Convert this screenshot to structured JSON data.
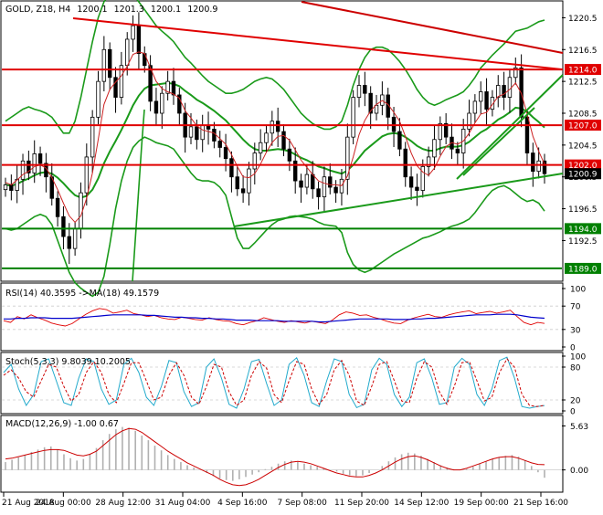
{
  "chart_data": [
    {
      "type": "candlestick",
      "title": "GOLD, Z18, H4",
      "ohlc": [
        "1200.1",
        "1201.3",
        "1200.1",
        "1200.9"
      ],
      "ylim": [
        1187.5,
        1222.5
      ],
      "yticks": [
        1192.5,
        1196.5,
        1200.5,
        1204.5,
        1208.5,
        1212.5,
        1216.5,
        1220.5
      ],
      "ytick_labels": [
        "1192.5",
        "1196.5",
        "1200.5",
        "1204.5",
        "1208.5",
        "1212.5",
        "1216.5",
        "1220.5"
      ],
      "xtick_labels": [
        "21 Aug 2018",
        "24 Aug 00:00",
        "28 Aug 12:00",
        "31 Aug 04:00",
        "4 Sep 16:00",
        "7 Sep 08:00",
        "11 Sep 20:00",
        "14 Sep 12:00",
        "19 Sep 00:00",
        "21 Sep 16:00"
      ],
      "horizontal_levels": [
        {
          "value": 1214.0,
          "label": "1214.0",
          "color": "#e00000"
        },
        {
          "value": 1207.0,
          "label": "1207.0",
          "color": "#e00000"
        },
        {
          "value": 1202.0,
          "label": "1202.0",
          "color": "#e00000"
        },
        {
          "value": 1194.0,
          "label": "1194.0",
          "color": "#008000"
        },
        {
          "value": 1189.0,
          "label": "1189.0",
          "color": "#008000"
        }
      ],
      "current_price": {
        "value": 1200.9,
        "label": "1200.9"
      },
      "closes": [
        1199.5,
        1198.8,
        1200.2,
        1202.5,
        1201.0,
        1203.4,
        1202.2,
        1200.5,
        1197.8,
        1195.5,
        1193.0,
        1191.5,
        1194.0,
        1198.5,
        1203.0,
        1208.0,
        1212.5,
        1216.5,
        1213.0,
        1210.5,
        1214.5,
        1217.8,
        1219.5,
        1216.0,
        1214.5,
        1210.0,
        1208.5,
        1211.0,
        1212.5,
        1210.8,
        1208.5,
        1205.5,
        1206.8,
        1205.2,
        1207.0,
        1206.5,
        1205.0,
        1204.2,
        1202.8,
        1200.5,
        1199.0,
        1198.5,
        1201.5,
        1203.5,
        1204.8,
        1206.0,
        1207.5,
        1206.2,
        1204.0,
        1202.5,
        1200.0,
        1199.2,
        1200.8,
        1199.0,
        1198.0,
        1200.5,
        1199.2,
        1198.5,
        1200.2,
        1205.5,
        1210.5,
        1212.0,
        1211.0,
        1208.5,
        1209.5,
        1210.8,
        1208.0,
        1206.2,
        1204.0,
        1200.5,
        1199.2,
        1198.8,
        1201.8,
        1203.0,
        1205.2,
        1207.2,
        1205.5,
        1204.0,
        1203.5,
        1206.5,
        1208.5,
        1210.0,
        1211.2,
        1209.0,
        1210.5,
        1212.0,
        1210.5,
        1213.0,
        1214.2,
        1208.0,
        1203.5,
        1201.2,
        1202.5,
        1200.9
      ],
      "sma_fast": [
        1199.8,
        1199.5,
        1200.1,
        1200.8,
        1201.2,
        1201.8,
        1202.0,
        1201.6,
        1200.4,
        1198.9,
        1197.2,
        1195.6,
        1194.8,
        1195.6,
        1197.8,
        1201.0,
        1205.2,
        1209.6,
        1211.5,
        1212.4,
        1213.2,
        1214.4,
        1215.9,
        1216.2,
        1216.0,
        1214.2,
        1212.5,
        1211.6,
        1211.2,
        1210.9,
        1210.4,
        1208.8,
        1207.9,
        1206.9,
        1206.4,
        1206.2,
        1206.0,
        1205.3,
        1204.6,
        1203.3,
        1201.8,
        1200.5,
        1200.4,
        1200.9,
        1202.1,
        1203.6,
        1204.8,
        1205.6,
        1205.7,
        1205.1,
        1203.9,
        1202.6,
        1201.7,
        1200.8,
        1200.0,
        1199.7,
        1199.5,
        1199.5,
        1199.4,
        1200.6,
        1203.0,
        1205.8,
        1207.6,
        1208.8,
        1209.6,
        1210.1,
        1209.6,
        1208.6,
        1207.5,
        1205.6,
        1203.5,
        1201.9,
        1201.1,
        1200.7,
        1201.6,
        1203.1,
        1204.3,
        1204.8,
        1204.6,
        1205.0,
        1206.0,
        1207.3,
        1208.4,
        1208.6,
        1209.6,
        1210.6,
        1210.9,
        1211.5,
        1212.3,
        1211.0,
        1208.4,
        1205.6,
        1203.7,
        1202.1
      ],
      "sma_slow": [
        1199.5,
        1199.4,
        1199.6,
        1200.0,
        1200.3,
        1200.7,
        1201.0,
        1201.1,
        1200.9,
        1200.4,
        1199.7,
        1198.9,
        1198.2,
        1197.9,
        1198.1,
        1198.9,
        1200.3,
        1202.2,
        1203.7,
        1205.0,
        1206.4,
        1207.9,
        1209.5,
        1210.7,
        1211.6,
        1212.0,
        1212.1,
        1212.2,
        1212.3,
        1212.2,
        1211.9,
        1211.3,
        1210.8,
        1210.2,
        1209.8,
        1209.3,
        1208.8,
        1208.2,
        1207.6,
        1206.8,
        1206.0,
        1205.2,
        1204.5,
        1204.0,
        1203.8,
        1203.8,
        1203.9,
        1204.0,
        1203.9,
        1203.7,
        1203.3,
        1202.9,
        1202.6,
        1202.2,
        1201.8,
        1201.6,
        1201.3,
        1201.1,
        1200.9,
        1201.3,
        1202.0,
        1202.9,
        1203.8,
        1204.4,
        1205.0,
        1205.6,
        1205.9,
        1206.0,
        1205.9,
        1205.5,
        1205.0,
        1204.4,
        1204.0,
        1203.8,
        1203.8,
        1204.1,
        1204.3,
        1204.3,
        1204.3,
        1204.5,
        1204.9,
        1205.5,
        1206.1,
        1206.5,
        1207.1,
        1207.7,
        1208.1,
        1208.6,
        1209.2,
        1209.1,
        1208.7,
        1208.0,
        1207.4,
        1206.7
      ],
      "bollinger_upper": [
        1207.5,
        1208.0,
        1208.5,
        1209.0,
        1209.3,
        1209.0,
        1208.8,
        1208.5,
        1208.0,
        1207.0,
        1206.0,
        1206.0,
        1207.5,
        1210.5,
        1214.0,
        1217.5,
        1220.5,
        1222.5,
        1223.5,
        1223.8,
        1224.0,
        1224.0,
        1223.5,
        1222.5,
        1221.5,
        1220.5,
        1219.5,
        1218.8,
        1218.2,
        1217.5,
        1216.5,
        1215.5,
        1214.8,
        1214.0,
        1213.2,
        1212.5,
        1212.0,
        1211.5,
        1211.0,
        1211.0,
        1211.2,
        1211.5,
        1212.0,
        1212.5,
        1212.8,
        1213.0,
        1212.8,
        1212.2,
        1211.5,
        1210.5,
        1209.5,
        1208.5,
        1207.8,
        1207.2,
        1206.8,
        1206.5,
        1206.5,
        1206.8,
        1207.5,
        1209.5,
        1212.0,
        1214.0,
        1215.5,
        1216.5,
        1216.8,
        1216.8,
        1216.5,
        1215.8,
        1215.0,
        1214.0,
        1212.8,
        1211.5,
        1210.5,
        1209.8,
        1209.5,
        1209.8,
        1210.2,
        1210.5,
        1210.8,
        1211.2,
        1212.0,
        1213.0,
        1214.2,
        1215.0,
        1215.8,
        1216.5,
        1217.2,
        1218.0,
        1218.8,
        1219.0,
        1219.2,
        1219.6,
        1220.0,
        1220.2
      ],
      "bollinger_lower": [
        1194.0,
        1193.8,
        1194.0,
        1194.5,
        1195.0,
        1195.5,
        1195.8,
        1195.5,
        1194.5,
        1192.5,
        1190.5,
        1188.5,
        1187.2,
        1186.5,
        1186.0,
        1185.5,
        1186.0,
        1188.0,
        1192.0,
        1196.5,
        1200.0,
        1202.5,
        1204.2,
        1205.0,
        1205.5,
        1205.2,
        1204.8,
        1204.6,
        1204.4,
        1204.0,
        1203.0,
        1202.0,
        1201.0,
        1200.2,
        1200.0,
        1200.0,
        1199.8,
        1199.2,
        1198.2,
        1195.5,
        1192.8,
        1191.5,
        1191.5,
        1192.2,
        1193.0,
        1193.8,
        1194.5,
        1195.0,
        1195.2,
        1195.5,
        1195.6,
        1195.5,
        1195.4,
        1195.2,
        1194.8,
        1194.5,
        1194.4,
        1194.3,
        1193.5,
        1191.0,
        1189.5,
        1188.8,
        1188.5,
        1188.8,
        1189.3,
        1189.8,
        1190.3,
        1190.8,
        1191.2,
        1191.6,
        1192.0,
        1192.4,
        1192.8,
        1193.0,
        1193.3,
        1193.6,
        1194.0,
        1194.3,
        1194.5,
        1194.8,
        1195.2,
        1196.0,
        1197.0,
        1198.0,
        1198.8,
        1199.2,
        1199.4,
        1199.0,
        1198.4,
        1197.8,
        1197.4,
        1197.6,
        1197.2,
        1196.2
      ]
    },
    {
      "type": "line",
      "title": "RSI(14) 40.3595  ->MA(18) 49.1579",
      "ylim": [
        0,
        100
      ],
      "yticks": [
        0,
        30,
        70,
        100
      ],
      "ytick_labels": [
        "0",
        "30",
        "70",
        "100"
      ],
      "series": [
        {
          "name": "RSI(14)",
          "color": "#e00000",
          "values": [
            45,
            42,
            52,
            48,
            55,
            50,
            46,
            41,
            38,
            36,
            40,
            48,
            56,
            62,
            66,
            64,
            58,
            60,
            63,
            57,
            55,
            52,
            54,
            50,
            48,
            47,
            51,
            49,
            47,
            46,
            50,
            47,
            45,
            44,
            40,
            38,
            42,
            45,
            50,
            47,
            44,
            42,
            45,
            43,
            41,
            44,
            42,
            40,
            46,
            55,
            60,
            58,
            54,
            55,
            51,
            48,
            44,
            41,
            40,
            46,
            50,
            53,
            56,
            52,
            51,
            55,
            58,
            60,
            62,
            57,
            59,
            61,
            58,
            60,
            63,
            52,
            42,
            38,
            42,
            40.36
          ]
        },
        {
          "name": "MA(18)",
          "color": "#0000cc",
          "values": [
            48,
            48,
            49,
            49,
            50,
            50,
            50,
            49,
            49,
            49,
            49,
            50,
            51,
            52,
            53,
            54,
            55,
            55,
            55,
            55,
            55,
            54,
            54,
            53,
            52,
            51,
            51,
            50,
            50,
            49,
            49,
            48,
            48,
            47,
            46,
            46,
            46,
            45,
            45,
            45,
            45,
            44,
            44,
            44,
            44,
            44,
            43,
            43,
            44,
            45,
            46,
            47,
            48,
            48,
            48,
            48,
            48,
            47,
            47,
            47,
            48,
            48,
            49,
            49,
            50,
            51,
            52,
            53,
            54,
            55,
            55,
            55,
            56,
            56,
            56,
            55,
            53,
            51,
            50,
            49.16
          ]
        }
      ]
    },
    {
      "type": "line",
      "title": "Stoch(5,3,3) 9.8039 10.2005",
      "ylim": [
        0,
        100
      ],
      "yticks": [
        0,
        20,
        80,
        100
      ],
      "ytick_labels": [
        "0",
        "20",
        "80",
        "100"
      ],
      "series": [
        {
          "name": "%K",
          "color": "#22aacc",
          "values": [
            70,
            85,
            40,
            10,
            30,
            90,
            95,
            55,
            15,
            10,
            60,
            95,
            90,
            40,
            12,
            20,
            85,
            96,
            70,
            25,
            10,
            45,
            92,
            88,
            35,
            8,
            15,
            80,
            95,
            60,
            12,
            5,
            40,
            90,
            94,
            50,
            10,
            20,
            85,
            97,
            65,
            15,
            8,
            55,
            95,
            90,
            30,
            6,
            12,
            75,
            96,
            85,
            30,
            8,
            25,
            88,
            95,
            60,
            12,
            15,
            80,
            96,
            85,
            30,
            10,
            40,
            92,
            98,
            60,
            8,
            5,
            8,
            9.8
          ]
        },
        {
          "name": "%D",
          "color": "#cc0000",
          "values": [
            65,
            75,
            60,
            35,
            25,
            55,
            85,
            80,
            45,
            18,
            30,
            70,
            90,
            70,
            30,
            15,
            50,
            88,
            88,
            55,
            20,
            25,
            65,
            88,
            65,
            25,
            12,
            45,
            85,
            80,
            35,
            10,
            20,
            65,
            90,
            78,
            30,
            15,
            55,
            90,
            85,
            40,
            12,
            30,
            75,
            92,
            65,
            18,
            10,
            45,
            85,
            90,
            55,
            18,
            15,
            60,
            90,
            80,
            35,
            12,
            45,
            88,
            90,
            55,
            18,
            25,
            70,
            95,
            80,
            30,
            10,
            8,
            10.2
          ]
        }
      ]
    },
    {
      "type": "bar",
      "title": "MACD(12,26,9) -1.00 0.67",
      "ylim": [
        -2.5,
        6.5
      ],
      "yticks": [
        0.0,
        5.63
      ],
      "ytick_labels": [
        "0.00",
        "5.63"
      ],
      "histogram": [
        1.0,
        1.3,
        1.6,
        1.9,
        2.3,
        2.6,
        2.9,
        3.0,
        2.6,
        2.0,
        1.5,
        1.2,
        1.4,
        2.0,
        2.8,
        3.8,
        4.6,
        5.2,
        5.5,
        5.4,
        5.0,
        4.4,
        3.8,
        3.1,
        2.5,
        1.9,
        1.4,
        1.0,
        0.6,
        0.3,
        0.0,
        -0.4,
        -0.8,
        -1.1,
        -1.3,
        -1.4,
        -1.2,
        -0.9,
        -0.6,
        -0.3,
        0.1,
        0.4,
        0.8,
        1.1,
        1.2,
        1.0,
        0.8,
        0.6,
        0.4,
        0.2,
        0.0,
        -0.2,
        -0.5,
        -0.7,
        -0.8,
        -0.7,
        -0.4,
        0.0,
        0.5,
        1.1,
        1.6,
        2.0,
        2.2,
        2.1,
        1.8,
        1.4,
        1.0,
        0.6,
        0.3,
        0.1,
        0.0,
        0.1,
        0.4,
        0.8,
        1.1,
        1.4,
        1.6,
        1.8,
        1.9,
        1.7,
        1.2,
        0.5,
        -0.3,
        -1.0
      ],
      "signal": [
        1.4,
        1.5,
        1.7,
        1.9,
        2.1,
        2.3,
        2.5,
        2.6,
        2.6,
        2.5,
        2.2,
        1.9,
        1.8,
        2.0,
        2.4,
        3.1,
        3.8,
        4.5,
        5.0,
        5.3,
        5.2,
        4.8,
        4.2,
        3.6,
        3.0,
        2.4,
        1.9,
        1.4,
        0.9,
        0.5,
        0.1,
        -0.3,
        -0.7,
        -1.2,
        -1.6,
        -1.9,
        -2.0,
        -1.9,
        -1.6,
        -1.2,
        -0.7,
        -0.2,
        0.3,
        0.7,
        1.0,
        1.1,
        1.0,
        0.8,
        0.5,
        0.2,
        -0.1,
        -0.4,
        -0.6,
        -0.8,
        -0.9,
        -0.9,
        -0.7,
        -0.4,
        0.0,
        0.5,
        1.0,
        1.4,
        1.7,
        1.8,
        1.6,
        1.3,
        0.9,
        0.5,
        0.2,
        0.0,
        0.0,
        0.2,
        0.5,
        0.8,
        1.1,
        1.4,
        1.6,
        1.7,
        1.7,
        1.5,
        1.2,
        0.9,
        0.7,
        0.67
      ]
    }
  ]
}
